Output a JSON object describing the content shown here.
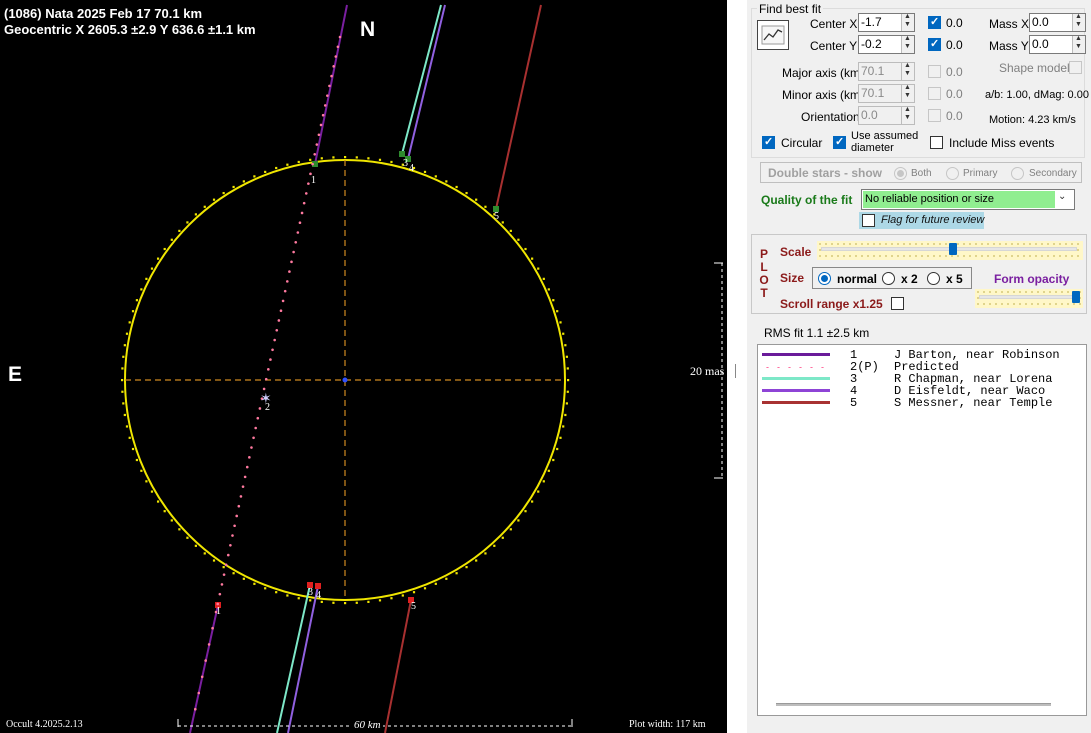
{
  "plot": {
    "title_line1": "(1086) Nata  2025 Feb 17  70.1 km",
    "title_line2": "Geocentric X 2605.3 ±2.9 Y 636.6 ±1.1 km",
    "north": "N",
    "east": "E",
    "scale_mas": "20 mas",
    "scale_km": "60 km",
    "version": "Occult 4.2025.2.13",
    "plot_width": "Plot width: 117 km",
    "chord_labels": [
      "1",
      "2",
      "3",
      "4",
      "5"
    ],
    "colors": {
      "ellipse": "#f0e600",
      "axes": "#d08a20",
      "chord1": "#7a1fa0",
      "predicted": "#ff7aa0",
      "chord3": "#7de8c8",
      "chord4": "#9060e0",
      "chord5": "#a83030",
      "event_d": "#2e8b2e",
      "event_r": "#e02020"
    }
  },
  "panel": {
    "find_best_fit": "Find best fit",
    "center_x_label": "Center X",
    "center_x_value": "-1.7",
    "center_x_fixed": "0.0",
    "center_y_label": "Center Y",
    "center_y_value": "-0.2",
    "center_y_fixed": "0.0",
    "mass_x_label": "Mass X",
    "mass_x_value": "0.0",
    "mass_y_label": "Mass Y",
    "mass_y_value": "0.0",
    "shape_model_label": "Shape model",
    "major_axis_label": "Major axis (km)",
    "major_axis_value": "70.1",
    "major_axis_fixed": "0.0",
    "minor_axis_label": "Minor axis (km)",
    "minor_axis_value": "70.1",
    "minor_axis_fixed": "0.0",
    "orientation_label": "Orientation",
    "orientation_value": "0.0",
    "orientation_fixed": "0.0",
    "ab_dmag": "a/b: 1.00, dMag: 0.00",
    "motion": "Motion: 4.23 km/s",
    "circular_label": "Circular",
    "use_assumed_label_1": "Use assumed",
    "use_assumed_label_2": "diameter",
    "include_miss_label": "Include Miss events",
    "double_stars_label": "Double stars - show",
    "both_label": "Both",
    "primary_label": "Primary",
    "secondary_label": "Secondary",
    "quality_label": "Quality of the fit",
    "quality_value": "No reliable position or size",
    "flag_label": "Flag for future review",
    "plot_letters": [
      "P",
      "L",
      "O",
      "T"
    ],
    "scale_label": "Scale",
    "size_label": "Size",
    "size_normal": "normal",
    "size_x2": "x 2",
    "size_x5": "x 5",
    "form_opacity_label": "Form opacity",
    "scroll_range_label": "Scroll range x1.25",
    "rms_fit": "RMS fit 1.1 ±2.5 km",
    "legend": [
      {
        "num": "1",
        "name": "J Barton, near Robinson",
        "color": "#6a1b9a",
        "style": "solid"
      },
      {
        "num": "2(P)",
        "name": "Predicted",
        "color": "#ff6fa0",
        "style": "dotted"
      },
      {
        "num": "3",
        "name": "R Chapman, near Lorena",
        "color": "#7de8c8",
        "style": "solid"
      },
      {
        "num": "4",
        "name": "D Eisfeldt, near Waco",
        "color": "#8e44d6",
        "style": "solid"
      },
      {
        "num": "5",
        "name": "S Messner, near Temple",
        "color": "#a83232",
        "style": "solid"
      }
    ]
  }
}
